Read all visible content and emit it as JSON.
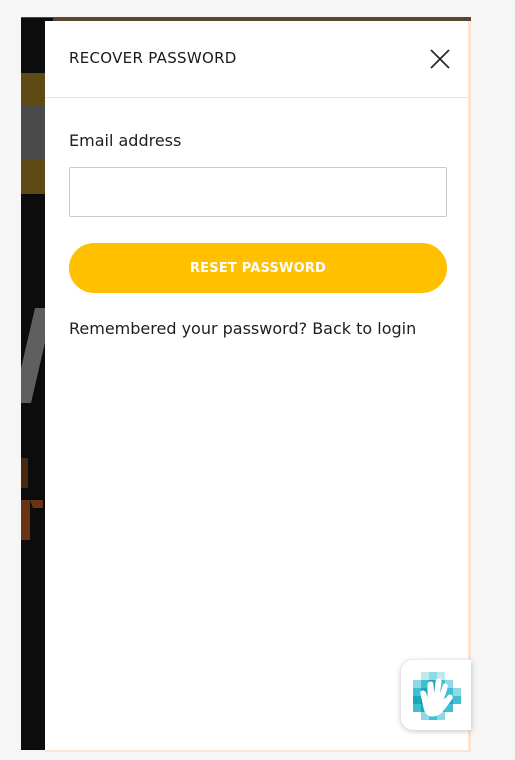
{
  "drawer": {
    "title": "RECOVER PASSWORD",
    "close_icon": "close-icon"
  },
  "form": {
    "email_label": "Email address",
    "email_value": "",
    "email_placeholder": "",
    "reset_button_label": "RESET PASSWORD",
    "remember_text": "Remembered your password?",
    "back_link_label": "Back to login"
  },
  "widget": {
    "icon": "accessibility-hand-icon"
  },
  "colors": {
    "accent": "#ffc000",
    "panel_border": "#fce3d4",
    "background_page": "#0c0c0c"
  }
}
